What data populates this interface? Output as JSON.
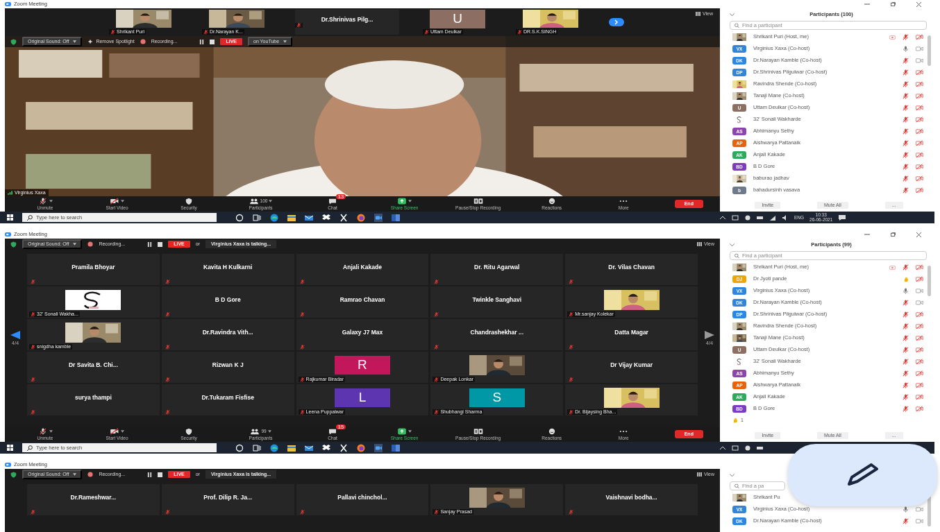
{
  "screens": [
    {
      "title": "Zoom Meeting",
      "kind": "speaker",
      "thumbnails": [
        {
          "kind": "video",
          "name": "Shrikant Puri"
        },
        {
          "kind": "video",
          "name": "Dr.Narayan K..."
        },
        {
          "kind": "name",
          "name": "Dr.Shrinivas  Pilg..."
        },
        {
          "kind": "letter",
          "letter": "U",
          "color": "#8d6e63",
          "name": "Uttam Deulkar"
        },
        {
          "kind": "video",
          "name": "DR.S.K.SINGH"
        }
      ],
      "top_bar": [
        {
          "kind": "dropdown",
          "label": "Original Sound: Off"
        },
        {
          "kind": "action",
          "label": "Remove Spotlight"
        },
        {
          "kind": "recording",
          "label": "Recording..."
        },
        {
          "kind": "live",
          "label": "LIVE"
        },
        {
          "kind": "dropdown",
          "label": "on YouTube"
        }
      ],
      "view_label": "View",
      "speaker": {
        "name": "Virginius Xaxa"
      },
      "toolbar": [
        {
          "kind": "mic",
          "label": "Unmute"
        },
        {
          "kind": "video",
          "label": "Start Video"
        },
        {
          "kind": "security",
          "label": "Security"
        },
        {
          "kind": "participants",
          "label": "Participants",
          "count": "100"
        },
        {
          "kind": "chat",
          "label": "Chat",
          "badge": "13"
        },
        {
          "kind": "share",
          "label": "Share Screen"
        },
        {
          "kind": "recording",
          "label": "Pause/Stop Recording"
        },
        {
          "kind": "reactions",
          "label": "Reactions"
        },
        {
          "kind": "more",
          "label": "More"
        },
        {
          "kind": "end",
          "label": "End"
        }
      ],
      "participants": {
        "title": "Participants (100)",
        "search_placeholder": "Find a participant",
        "rows": [
          {
            "name": "Shrikant Puri (Host, me)",
            "mic_muted": true,
            "video_on": false,
            "recording": true
          },
          {
            "kind": "initials",
            "initials": "VX",
            "color": "#2e86de",
            "name": "Virginius Xaxa (Co-host)",
            "mic_muted": false,
            "video_on": true,
            "recording": false
          },
          {
            "kind": "initials",
            "initials": "DK",
            "color": "#2e86de",
            "name": "Dr.Narayan Kamble (Co-host)",
            "mic_muted": true,
            "video_on": true,
            "recording": false
          },
          {
            "kind": "initials",
            "initials": "DP",
            "color": "#2e86de",
            "name": "Dr.Shrinivas Pilgulwar (Co-host)",
            "mic_muted": true,
            "video_on": false,
            "recording": false
          },
          {
            "name": "Ravindra Shende (Co-host)",
            "mic_muted": true,
            "video_on": false,
            "recording": false
          },
          {
            "name": "Tanaji Mane (Co-host)",
            "mic_muted": true,
            "video_on": false,
            "recording": false
          },
          {
            "kind": "initials",
            "initials": "U",
            "color": "#8d6e63",
            "name": "Uttam Deulkar (Co-host)",
            "mic_muted": true,
            "video_on": false,
            "recording": false
          },
          {
            "name": "32' Sonali Wakharde",
            "mic_muted": true,
            "video_on": false,
            "recording": false
          },
          {
            "kind": "initials",
            "initials": "AS",
            "color": "#8e44ad",
            "name": "Abhimanyu Sethy",
            "mic_muted": true,
            "video_on": false,
            "recording": false
          },
          {
            "kind": "initials",
            "initials": "AP",
            "color": "#e8630a",
            "name": "Aishwarya Pattanaik",
            "mic_muted": true,
            "video_on": false,
            "recording": false
          },
          {
            "kind": "initials",
            "initials": "AK",
            "color": "#2eaa5c",
            "name": "Anjali Kakade",
            "mic_muted": true,
            "video_on": false,
            "recording": false
          },
          {
            "kind": "initials",
            "initials": "BD",
            "color": "#7d3cbf",
            "name": "B D Gore",
            "mic_muted": true,
            "video_on": false,
            "recording": false
          },
          {
            "name": "baburao jadhav",
            "mic_muted": true,
            "video_on": false,
            "recording": false
          },
          {
            "kind": "initials",
            "initials": "b",
            "color": "#6d7b8a",
            "name": "bahadursinh vasava",
            "mic_muted": true,
            "video_on": false,
            "recording": false
          }
        ],
        "buttons": [
          "Invite",
          "Mute All",
          "..."
        ]
      },
      "taskbar": {
        "search_placeholder": "Type here to search",
        "lang": "ENG",
        "time": "10:33",
        "date": "26-06-2021"
      }
    },
    {
      "title": "Zoom Meeting",
      "kind": "gallery",
      "top_bar": [
        {
          "kind": "dropdown",
          "label": "Original Sound: Off"
        },
        {
          "kind": "recording",
          "label": "Recording..."
        },
        {
          "kind": "live",
          "label": "LIVE"
        },
        {
          "kind": "text",
          "label": "or"
        },
        {
          "kind": "talking",
          "label": "Virginius Xaxa is talking..."
        }
      ],
      "view_label": "View",
      "pager": {
        "previous": "4/4",
        "next": "4/4"
      },
      "tiles": [
        {
          "kind": "name",
          "name": "Pramila Bhoyar"
        },
        {
          "kind": "name",
          "name": "Kavita H Kulkarni"
        },
        {
          "kind": "name",
          "name": "Anjali Kakade"
        },
        {
          "kind": "name",
          "name": "Dr. Ritu Agarwal"
        },
        {
          "kind": "name",
          "name": "Dr. Vilas Chavan"
        },
        {
          "name": "32' Sonali Wakha..."
        },
        {
          "kind": "name",
          "name": "B D Gore"
        },
        {
          "kind": "name",
          "name": "Ramrao Chavan"
        },
        {
          "kind": "name",
          "name": "Twinkle Sanghavi"
        },
        {
          "kind": "video",
          "name": "Mr.sanjay Kolekar"
        },
        {
          "kind": "video",
          "name": "snigdha kamble"
        },
        {
          "kind": "name",
          "name": "Dr.Ravindra  Vith..."
        },
        {
          "kind": "name",
          "name": "Galaxy J7 Max"
        },
        {
          "kind": "name",
          "name": "Chandrashekhar ..."
        },
        {
          "kind": "name",
          "name": "Datta Magar"
        },
        {
          "kind": "name",
          "name": "Dr Savita B. Chi..."
        },
        {
          "kind": "name",
          "name": "Rizwan K J"
        },
        {
          "kind": "letter",
          "letter": "R",
          "color": "#c2185b",
          "name": "Rajkumar Biradar"
        },
        {
          "kind": "video",
          "name": "Deepak Lonkar"
        },
        {
          "kind": "name",
          "name": "Dr Vijay Kumar"
        },
        {
          "kind": "name",
          "name": "surya thampi"
        },
        {
          "kind": "name",
          "name": "Dr.Tukaram Fisfise"
        },
        {
          "kind": "letter",
          "letter": "L",
          "color": "#5e35b1",
          "name": "Leena Puppalwar"
        },
        {
          "kind": "letter",
          "letter": "S",
          "color": "#0097a7",
          "name": "Shubhangi Sharma"
        },
        {
          "kind": "video",
          "name": "Dr. Bijaysing Bha..."
        }
      ],
      "toolbar": [
        {
          "kind": "mic",
          "label": "Unmute"
        },
        {
          "kind": "video",
          "label": "Start Video"
        },
        {
          "kind": "security",
          "label": "Security"
        },
        {
          "kind": "participants",
          "label": "Participants",
          "count": "99"
        },
        {
          "kind": "chat",
          "label": "Chat",
          "badge": "15"
        },
        {
          "kind": "share",
          "label": "Share Screen"
        },
        {
          "kind": "recording",
          "label": "Pause/Stop Recording"
        },
        {
          "kind": "reactions",
          "label": "Reactions"
        },
        {
          "kind": "more",
          "label": "More"
        },
        {
          "kind": "end",
          "label": "End"
        }
      ],
      "participants": {
        "title": "Participants (99)",
        "search_placeholder": "Find a participant",
        "rows": [
          {
            "name": "Shrikant Puri (Host, me)",
            "hand_raised": false,
            "mic_muted": true,
            "video_on": false,
            "recording": true
          },
          {
            "kind": "initials",
            "initials": "DJ",
            "color": "#f0a500",
            "name": "Dr Jyoti pande",
            "hand_raised": true,
            "video_on": false,
            "recording": false
          },
          {
            "kind": "initials",
            "initials": "VX",
            "color": "#2e86de",
            "name": "Virginius Xaxa (Co-host)",
            "hand_raised": false,
            "mic_muted": false,
            "video_on": true,
            "recording": false
          },
          {
            "kind": "initials",
            "initials": "DK",
            "color": "#2e86de",
            "name": "Dr.Narayan Kamble (Co-host)",
            "hand_raised": false,
            "mic_muted": true,
            "video_on": true,
            "recording": false
          },
          {
            "kind": "initials",
            "initials": "DP",
            "color": "#2e86de",
            "name": "Dr.Shrinivas Pilgulwar (Co-host)",
            "hand_raised": false,
            "mic_muted": true,
            "video_on": false,
            "recording": false
          },
          {
            "name": "Ravindra Shende (Co-host)",
            "hand_raised": false,
            "mic_muted": true,
            "video_on": false,
            "recording": false
          },
          {
            "name": "Tanaji Mane (Co-host)",
            "hand_raised": false,
            "mic_muted": true,
            "video_on": false,
            "recording": false
          },
          {
            "kind": "initials",
            "initials": "U",
            "color": "#8d6e63",
            "name": "Uttam Deulkar (Co-host)",
            "hand_raised": false,
            "mic_muted": true,
            "video_on": false,
            "recording": false
          },
          {
            "name": "32' Sonali Wakharde",
            "hand_raised": false,
            "mic_muted": true,
            "video_on": false,
            "recording": false
          },
          {
            "kind": "initials",
            "initials": "AS",
            "color": "#8e44ad",
            "name": "Abhimanyu Sethy",
            "hand_raised": false,
            "mic_muted": true,
            "video_on": false,
            "recording": false
          },
          {
            "kind": "initials",
            "initials": "AP",
            "color": "#e8630a",
            "name": "Aishwarya Pattanaik",
            "hand_raised": false,
            "mic_muted": true,
            "video_on": false,
            "recording": false
          },
          {
            "kind": "initials",
            "initials": "AK",
            "color": "#2eaa5c",
            "name": "Anjali Kakade",
            "hand_raised": false,
            "mic_muted": true,
            "video_on": false,
            "recording": false
          },
          {
            "kind": "initials",
            "initials": "BD",
            "color": "#7d3cbf",
            "name": "B D Gore",
            "hand_raised": false,
            "mic_muted": true,
            "video_on": false,
            "recording": false
          }
        ],
        "raised_hands": "1",
        "buttons": [
          "Invite",
          "Mute All",
          "..."
        ]
      },
      "taskbar": {
        "search_placeholder": "Type here to search"
      }
    },
    {
      "title": "Zoom Meeting",
      "kind": "gallery",
      "top_bar": [
        {
          "kind": "dropdown",
          "label": "Original Sound: Off"
        },
        {
          "kind": "recording",
          "label": "Recording..."
        },
        {
          "kind": "live",
          "label": "LIVE"
        },
        {
          "kind": "text",
          "label": "or"
        },
        {
          "kind": "talking",
          "label": "Virginius Xaxa is talking..."
        }
      ],
      "view_label": "View",
      "tiles": [
        {
          "kind": "name",
          "name": "Dr.Rameshwar..."
        },
        {
          "kind": "name",
          "name": "Prof. Dilip R. Ja..."
        },
        {
          "kind": "name",
          "name": "Pallavi  chinchol..."
        },
        {
          "kind": "video",
          "name": "Sanjay Prasad"
        },
        {
          "kind": "name",
          "name": "Vaishnavi  bodha..."
        }
      ],
      "participants": {
        "search_placeholder": "Find a pa",
        "rows": [
          {
            "name": "Shrikant Pu"
          },
          {
            "kind": "initials",
            "initials": "VX",
            "color": "#2e86de",
            "name": "Virginius Xaxa (Co-host)",
            "mic_muted": false,
            "video_on": true
          },
          {
            "kind": "initials",
            "initials": "DK",
            "color": "#2e86de",
            "name": "Dr.Narayan Kamble (Co-host)",
            "mic_muted": true,
            "video_on": true
          }
        ]
      }
    }
  ]
}
